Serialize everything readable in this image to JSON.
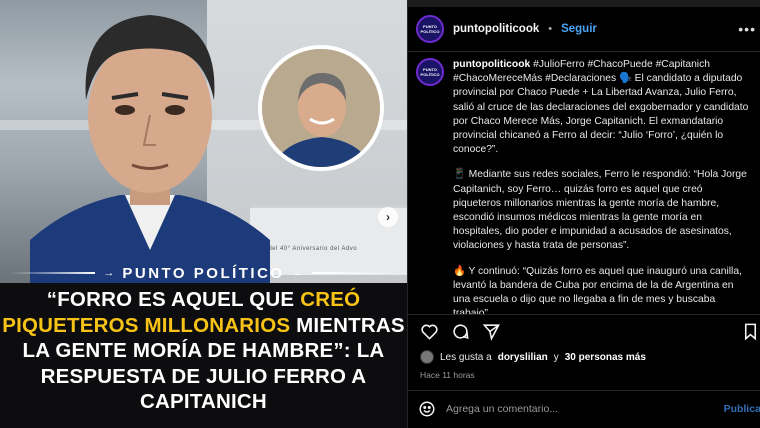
{
  "post": {
    "brand": "PUNTO POLÍTICO",
    "headline": {
      "part1": "“FORRO ES AQUEL QUE ",
      "highlight": "CREÓ PIQUETEROS MILLONARIOS",
      "part2": " MIENTRAS LA GENTE MORÍA DE HAMBRE”: LA RESPUESTA DE JULIO FERRO A CAPITANICH"
    },
    "sign_text": "ral del 40° Aniversario del Advo"
  },
  "account": {
    "avatar_text": "PUNTO POLÍTICO",
    "username": "puntopoliticook",
    "separator": "•",
    "follow_label": "Seguir",
    "more_label": "•••"
  },
  "caption": {
    "username": "puntopoliticook",
    "p1": "#JulioFerro #ChacoPuede #Capitanich #ChacoMereceMás #Declaraciones 🗣️ El candidato a diputado provincial por Chaco Puede + La Libertad Avanza, Julio Ferro, salió al cruce de las declaraciones del exgobernador y candidato por Chaco Merece Más, Jorge Capitanich. El exmandatario provincial chicaneó a Ferro al decir: “Julio ‘Forro’, ¿quién lo conoce?”.",
    "p2": "📱 Mediante sus redes sociales, Ferro le respondió: “Hola Jorge Capitanich, soy Ferro… quizás forro es aquel que creó piqueteros millonarios mientras la gente moría de hambre, escondió insumos médicos mientras la gente moría en hospitales, dio poder e impunidad a acusados de asesinatos, violaciones y hasta trata de personas”.",
    "p3": "🔥 Y continuó: “Quizás forro es aquel que inauguró una canilla, levantó la bandera de Cuba por encima de la de Argentina en una escuela o dijo que no llegaba a fin de mes y buscaba trabajo”."
  },
  "likes": {
    "prefix": "Les gusta a",
    "user": "doryslilian",
    "middle": "y",
    "others": "30 personas más"
  },
  "time": "Hace 11 horas",
  "comment": {
    "placeholder": "Agrega un comentario...",
    "publish_label": "Publicar"
  },
  "colors": {
    "follow": "#4aa3f5",
    "headline_highlight": "#f7c316",
    "background": "#000000"
  },
  "icons": [
    "heart-icon",
    "comment-icon",
    "share-icon",
    "bookmark-icon",
    "emoji-icon",
    "next-arrow-icon"
  ]
}
